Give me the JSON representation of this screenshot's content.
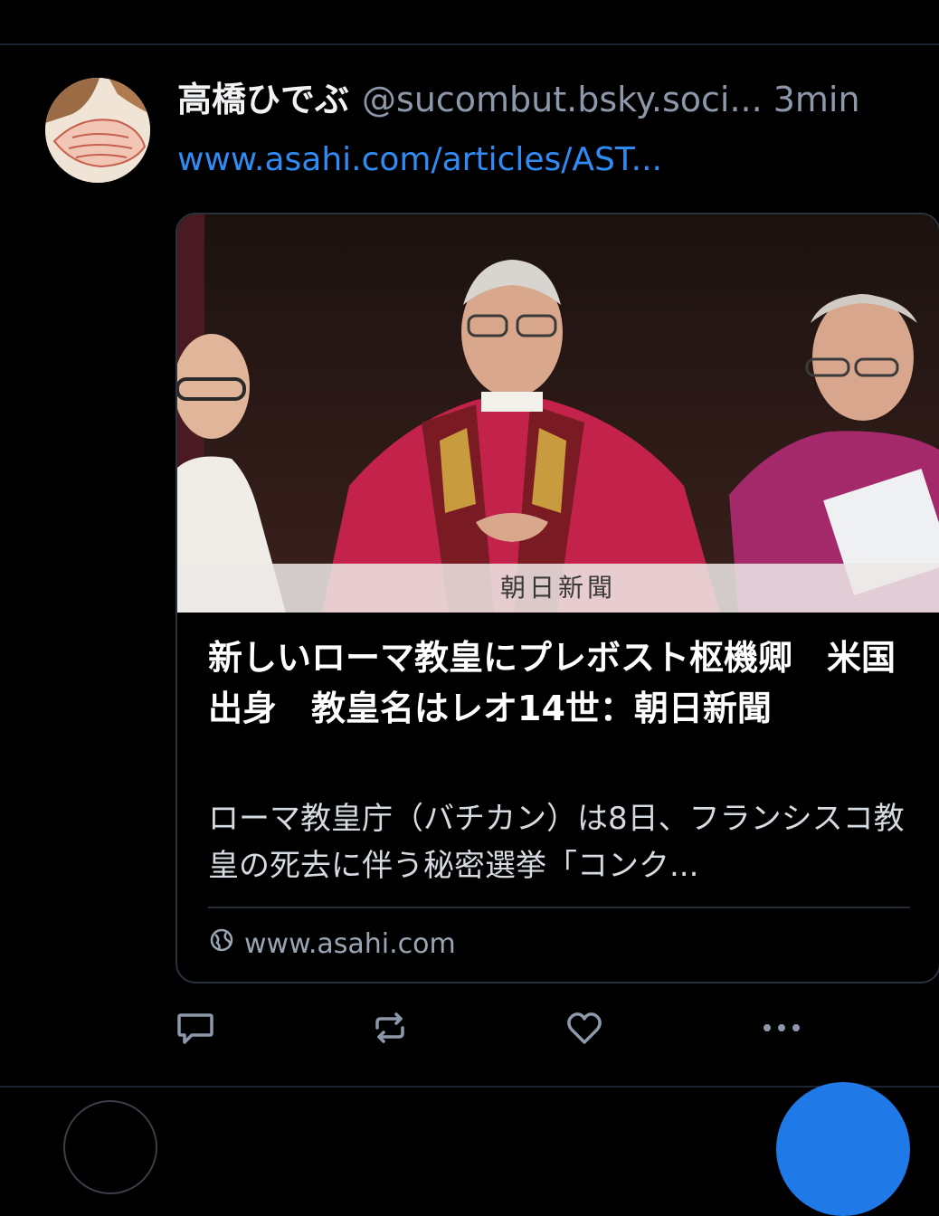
{
  "post": {
    "author_name": "高橋ひでぶ",
    "author_handle": "@sucombut.bsky.soci...",
    "time": "3min",
    "link_text": "www.asahi.com/articles/AST..."
  },
  "card": {
    "image_watermark": "朝日新聞",
    "title": "新しいローマ教皇にプレボスト枢機卿　米国出身　教皇名はレオ14世：朝日新聞",
    "description": "ローマ教皇庁（バチカン）は8日、フランシスコ教皇の死去に伴う秘密選挙「コンク...",
    "domain": "www.asahi.com"
  },
  "actions": {
    "reply_icon": "reply-icon",
    "repost_icon": "repost-icon",
    "like_icon": "like-icon",
    "more_icon": "more-icon"
  },
  "colors": {
    "background": "#000000",
    "link": "#2f8cf5",
    "muted": "#8d99aa",
    "border": "#2a323d",
    "fab": "#1f7ae8"
  }
}
